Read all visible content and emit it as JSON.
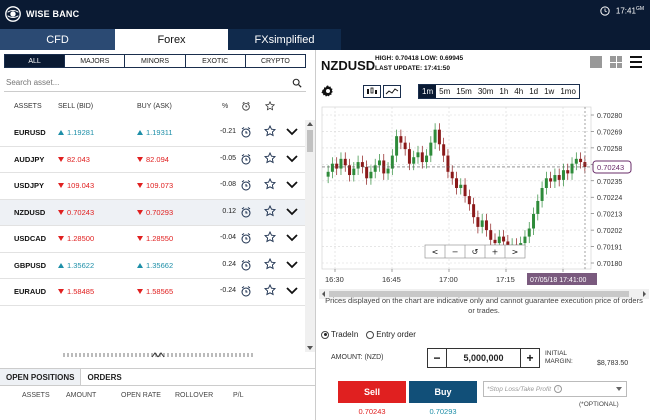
{
  "header": {
    "brand": "WISE BANC",
    "time": "17:41",
    "time_suffix": "GM"
  },
  "product_tabs": [
    "CFD",
    "Forex",
    "FXsimplified"
  ],
  "categories": [
    "ALL",
    "MAJORS",
    "MINORS",
    "EXOTIC",
    "CRYPTO"
  ],
  "search": {
    "placeholder": "Search asset..."
  },
  "table": {
    "headers": {
      "assets": "ASSETS",
      "sell": "SELL (BID)",
      "buy": "BUY (ASK)",
      "pct": "%"
    },
    "rows": [
      {
        "symbol": "EURUSD",
        "sell": "1.19281",
        "buy": "1.19311",
        "pct": "-0.21",
        "direction": "up"
      },
      {
        "symbol": "AUDJPY",
        "sell": "82.043",
        "buy": "82.094",
        "pct": "-0.05",
        "direction": "down"
      },
      {
        "symbol": "USDJPY",
        "sell": "109.043",
        "buy": "109.073",
        "pct": "-0.08",
        "direction": "down"
      },
      {
        "symbol": "NZDUSD",
        "sell": "0.70243",
        "buy": "0.70293",
        "pct": "0.12",
        "direction": "down"
      },
      {
        "symbol": "USDCAD",
        "sell": "1.28500",
        "buy": "1.28550",
        "pct": "-0.04",
        "direction": "down"
      },
      {
        "symbol": "GBPUSD",
        "sell": "1.35622",
        "buy": "1.35662",
        "pct": "0.24",
        "direction": "up"
      },
      {
        "symbol": "EURAUD",
        "sell": "1.58485",
        "buy": "1.58565",
        "pct": "-0.24",
        "direction": "down"
      }
    ]
  },
  "bottom_tabs": [
    "OPEN POSITIONS",
    "ORDERS"
  ],
  "bottom_headers": [
    "ASSETS",
    "AMOUNT",
    "OPEN RATE",
    "ROLLOVER",
    "P/L"
  ],
  "instrument": {
    "symbol": "NZDUSD",
    "high_label": "HIGH:",
    "high": "0.70418",
    "low_label": "LOW:",
    "low": "0.69945",
    "update_label": "LAST UPDATE:",
    "update": "17:41:50"
  },
  "timeframes": [
    "1m",
    "5m",
    "15m",
    "30m",
    "1h",
    "4h",
    "1d",
    "1w",
    "1mo"
  ],
  "active_timeframe": "1m",
  "chart_data": {
    "type": "candlestick",
    "y_ticks": [
      "0.70280",
      "0.70269",
      "0.70258",
      "0.70247",
      "0.70235",
      "0.70224",
      "0.70213",
      "0.70202",
      "0.70191",
      "0.70180"
    ],
    "x_ticks": [
      "16:30",
      "16:45",
      "17:00",
      "17:15",
      "17:"
    ],
    "ylim": [
      0.7018,
      0.7028
    ],
    "current_price": "0.70243",
    "crosshair_time": "07/05/18 17:41:00",
    "closes": [
      0.7024,
      0.70245,
      0.70242,
      0.70248,
      0.70244,
      0.70238,
      0.70242,
      0.70246,
      0.70243,
      0.70236,
      0.7024,
      0.70244,
      0.70247,
      0.70239,
      0.70242,
      0.7025,
      0.70262,
      0.70258,
      0.70254,
      0.70245,
      0.70249,
      0.70252,
      0.70246,
      0.7025,
      0.70258,
      0.70266,
      0.70257,
      0.7025,
      0.7024,
      0.70236,
      0.7023,
      0.70232,
      0.70225,
      0.7022,
      0.70212,
      0.70206,
      0.7021,
      0.70204,
      0.70198,
      0.70196,
      0.702,
      0.70197,
      0.70193,
      0.70195,
      0.70192,
      0.70196,
      0.702,
      0.70205,
      0.70214,
      0.70222,
      0.7023,
      0.70236,
      0.70234,
      0.70238,
      0.70235,
      0.70241,
      0.70239,
      0.70245,
      0.70248,
      0.70246,
      0.70243
    ]
  },
  "chart_nav": [
    "<",
    "−",
    "↺",
    "+",
    ">"
  ],
  "disclaimer": "Prices displayed on the chart are indicative only and cannot guarantee execution price of orders or trades.",
  "order": {
    "type_options": [
      "TradeIn",
      "Entry order"
    ],
    "amount_label": "AMOUNT: (NZD)",
    "amount": "5,000,000",
    "initial_margin_label": "INITIAL MARGIN:",
    "initial_margin": "$8,783.50",
    "sell_label": "Sell",
    "buy_label": "Buy",
    "sell_price": "0.70243",
    "buy_price": "0.70293",
    "stoploss_placeholder": "*Stop Loss/Take Profit",
    "optional_note": "(*OPTIONAL)"
  },
  "colors": {
    "up": "#1e8fa8",
    "down": "#e02020",
    "navy": "#0a1a33",
    "buy": "#114f78"
  }
}
